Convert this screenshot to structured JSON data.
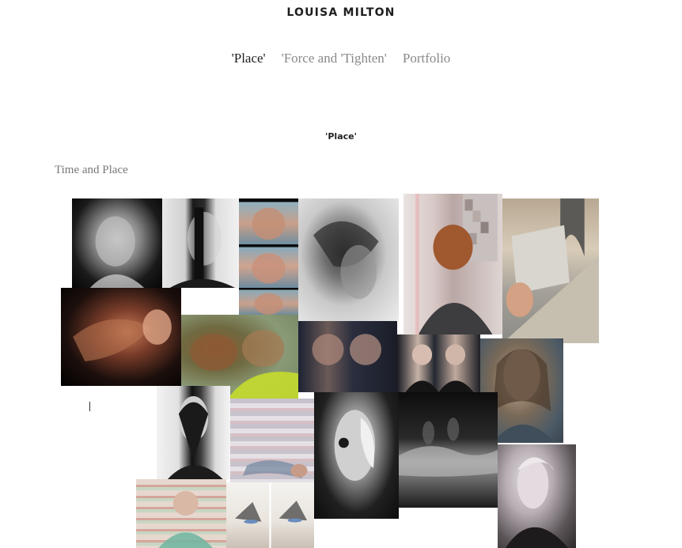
{
  "site": {
    "title": "LOUISA MILTON"
  },
  "nav": {
    "items": [
      {
        "label": "'Place'",
        "active": true
      },
      {
        "label": "'Force and 'Tighten'",
        "active": false
      },
      {
        "label": "Portfolio",
        "active": false
      }
    ]
  },
  "page": {
    "heading": "'Place'",
    "section_label": "Time and Place"
  },
  "collage": {
    "photos": [
      "portrait-smudged-face-photo",
      "portrait-hair-over-face-photo",
      "hands-over-face-sequence-photo",
      "hands-over-face-sequence-photo",
      "hands-over-face-sequence-photo",
      "blurred-hair-motion-photo",
      "pixelated-head-back-photo",
      "staircase-postcard-photo",
      "motion-blur-profile-photo",
      "blurred-two-heads-photo",
      "two-faces-blur-photo",
      "twin-portraits-photo",
      "painted-portrait-photo",
      "split-face-portrait-photo",
      "striped-reclining-figure-photo",
      "hand-over-face-portrait-photo",
      "long-exposure-figures-photo",
      "vintage-woman-portrait-photo",
      "striped-seated-woman-photo",
      "dancers-sequence-photo"
    ]
  }
}
